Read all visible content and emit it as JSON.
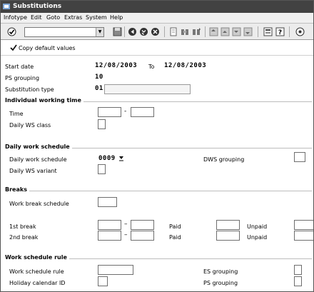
{
  "window": {
    "title": "Substitutions"
  },
  "menu": [
    "Infotype",
    "Edit",
    "Goto",
    "Extras",
    "System",
    "Help"
  ],
  "toolbar": {
    "command_field": ""
  },
  "app_toolbar": {
    "copy_label": "Copy default values"
  },
  "header": {
    "start_date_label": "Start date",
    "start_date": "12/08/2003",
    "to_label": "To",
    "end_date": "12/08/2003",
    "ps_grouping_label": "PS grouping",
    "ps_grouping": "10",
    "subst_type_label": "Substitution type",
    "subst_type": "01",
    "subst_type_text": ""
  },
  "individual": {
    "title": "Individual working time",
    "time_label": "Time",
    "time_from": "",
    "dash": "-",
    "time_to": "",
    "ws_class_label": "Daily WS class",
    "ws_class": ""
  },
  "daily": {
    "title": "Daily work schedule",
    "dws_label": "Daily work schedule",
    "dws_value": "0009",
    "dws_grouping_label": "DWS grouping",
    "dws_grouping": "",
    "variant_label": "Daily WS variant",
    "variant": ""
  },
  "breaks": {
    "title": "Breaks",
    "schedule_label": "Work break schedule",
    "schedule": "",
    "first_label": "1st break",
    "second_label": "2nd break",
    "dash": "–",
    "paid_label": "Paid",
    "unpaid_label": "Unpaid"
  },
  "wsr": {
    "title": "Work schedule rule",
    "rule_label": "Work schedule rule",
    "rule": "",
    "holiday_label": "Holiday calendar ID",
    "holiday": "",
    "es_label": "ES grouping",
    "es": "",
    "ps_label": "PS grouping",
    "ps": ""
  }
}
